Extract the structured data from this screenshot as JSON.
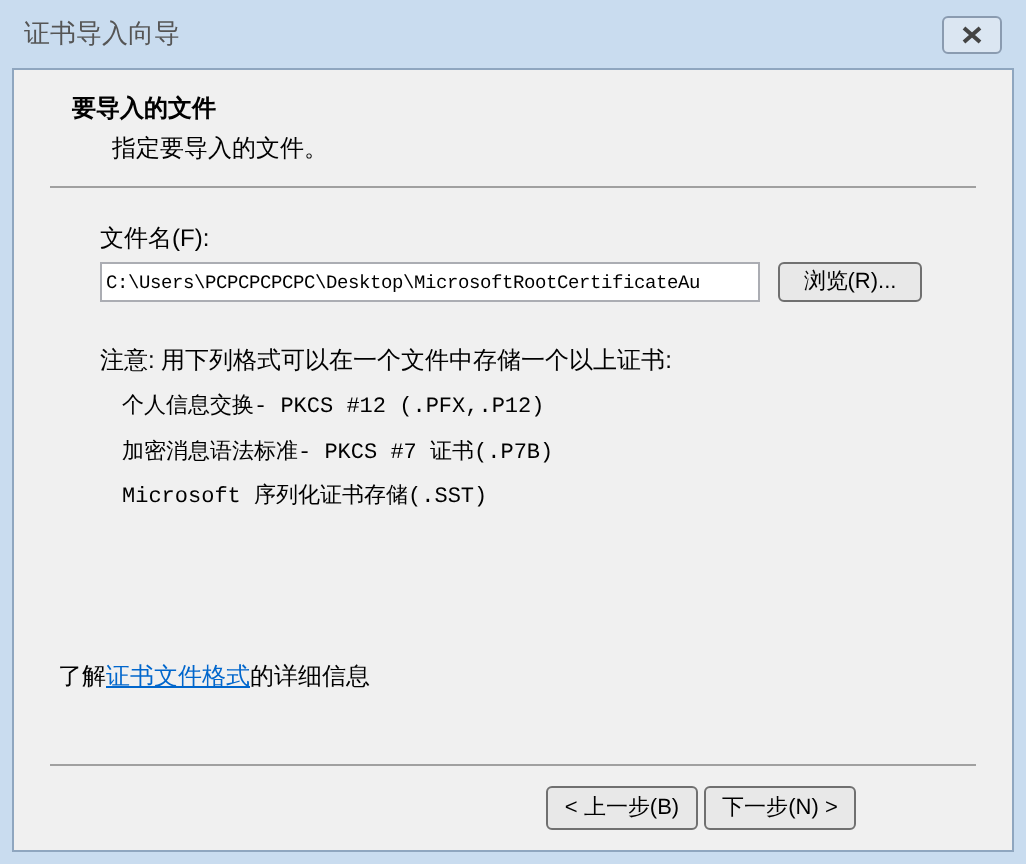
{
  "window": {
    "title": "证书导入向导"
  },
  "header": {
    "title": "要导入的文件",
    "subtitle": "指定要导入的文件。"
  },
  "file_field": {
    "label": "文件名(F):",
    "value": "C:\\Users\\PCPCPCPCPC\\Desktop\\MicrosoftRootCertificateAu"
  },
  "browse_button": "浏览(R)...",
  "note": "注意: 用下列格式可以在一个文件中存储一个以上证书:",
  "formats": [
    "个人信息交换- PKCS #12 (.PFX,.P12)",
    "加密消息语法标准- PKCS #7 证书(.P7B)",
    "Microsoft 序列化证书存储(.SST)"
  ],
  "info": {
    "before": "了解",
    "link": "证书文件格式",
    "after": "的详细信息"
  },
  "buttons": [
    "< 上一步(B)",
    "下一步(N) >"
  ]
}
